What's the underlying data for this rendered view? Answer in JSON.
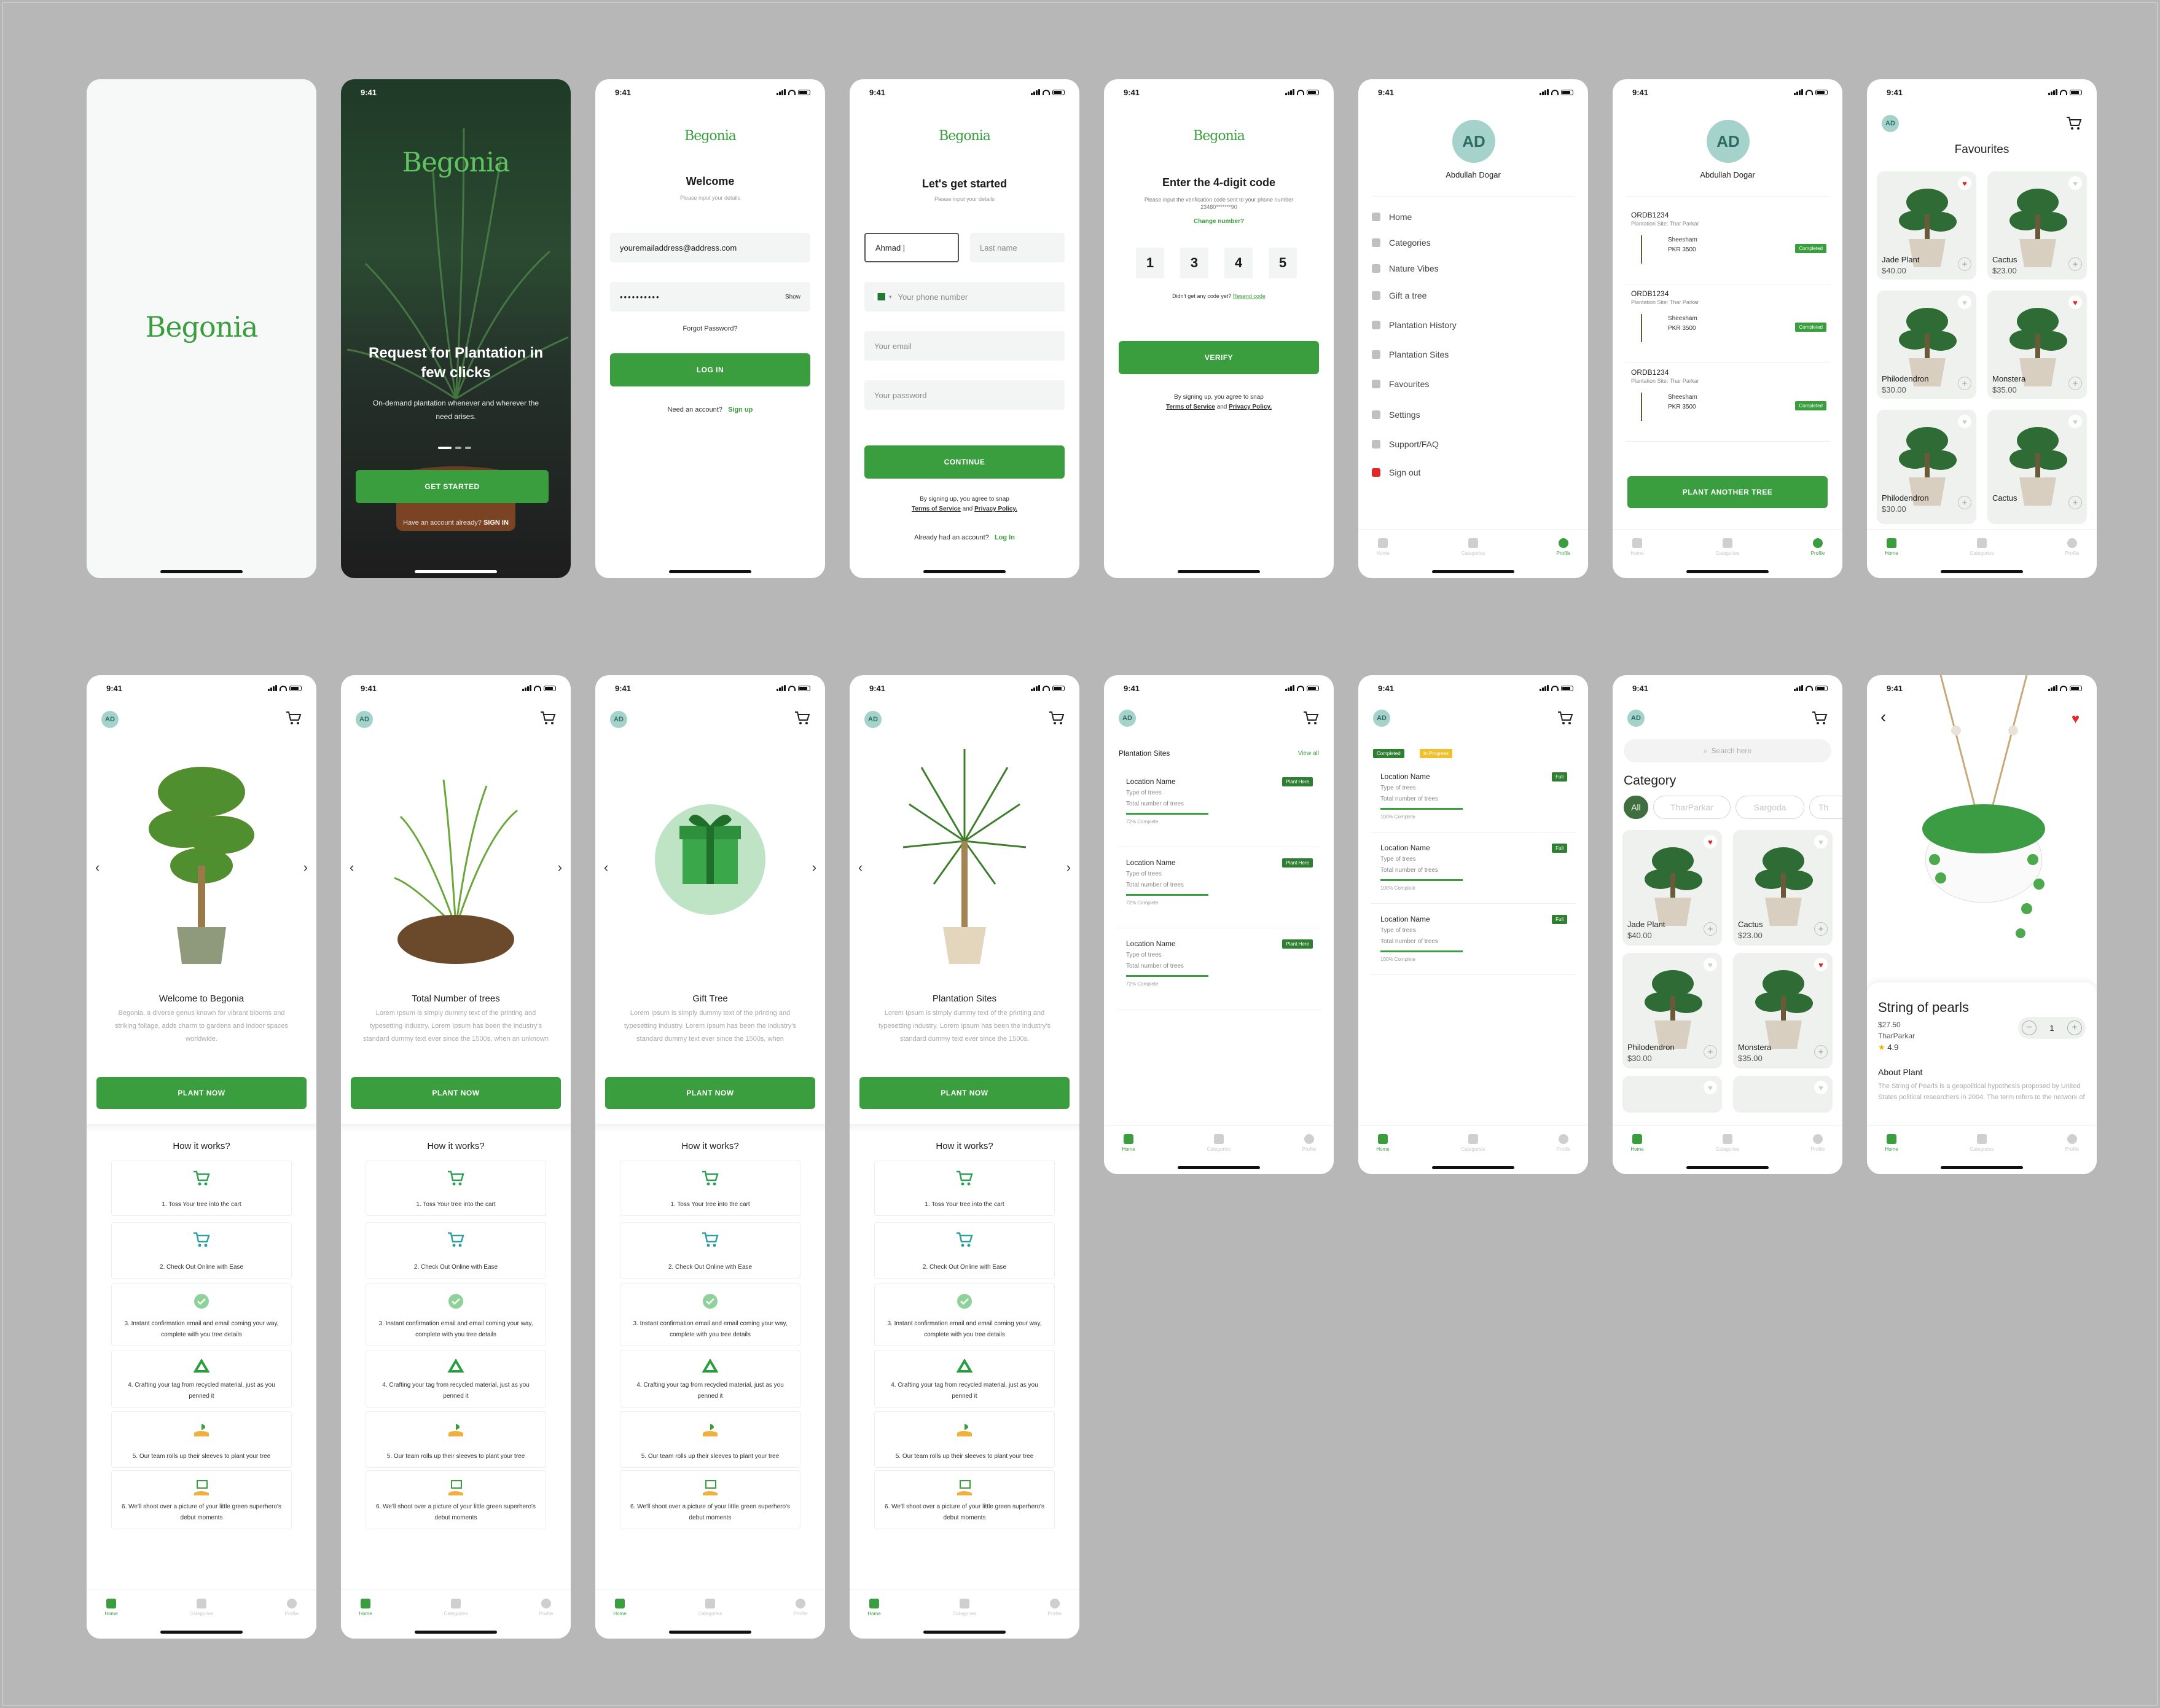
{
  "app": {
    "brand": "Begonia",
    "time": "9:41"
  },
  "splash2": {
    "title": "Request for Plantation in few clicks",
    "body": "On-demand plantation whenever and wherever the need arises.",
    "cta": "GET STARTED",
    "have_account": "Have an account already?",
    "sign_in": "SIGN IN"
  },
  "login": {
    "title": "Welcome",
    "subtitle": "Please input your details",
    "email": "youremailaddress@address.com",
    "password": "••••••••••",
    "show": "Show",
    "forgot": "Forgot Password?",
    "login_btn": "LOG IN",
    "need_account": "Need an account?",
    "sign_up": "Sign up"
  },
  "signup": {
    "title": "Let's get started",
    "subtitle": "Please input your details",
    "first_name": "Ahmad |",
    "last_name": "Last name",
    "phone": "Your phone number",
    "email": "Your email",
    "password": "Your password",
    "cta": "CONTINUE",
    "terms_prefix": "By signing up, you agree to snap",
    "terms": "Terms of Service",
    "and": "and",
    "privacy": "Privacy Policy.",
    "already": "Already had an account?",
    "log_in": "Log In"
  },
  "verify": {
    "title": "Enter the 4-digit code",
    "body": "Please input the verification code sent to your phone number 23480*******90",
    "change": "Change number?",
    "digits": [
      "1",
      "3",
      "4",
      "5"
    ],
    "resend_q": "Didn't get any code yet?",
    "resend": "Resend code",
    "cta": "VERIFY",
    "terms_prefix": "By signing up, you agree to snap",
    "terms": "Terms of Service",
    "and": "and",
    "privacy": "Privacy Policy."
  },
  "profile": {
    "initials": "AD",
    "name": "Abdullah Dogar",
    "menu": [
      "Home",
      "Categories",
      "Nature Vibes",
      "Gift a tree",
      "Plantation History",
      "Plantation Sites",
      "Favourites",
      "Settings",
      "Support/FAQ",
      "Sign out"
    ]
  },
  "nav": {
    "home": "Home",
    "categories": "Categories",
    "profile": "Profile"
  },
  "history": {
    "orders": [
      {
        "id": "ORDB1234",
        "site": "Plantation Site: Thar Parkar",
        "tree": "Sheesham",
        "price": "PKR 3500",
        "status": "Completed"
      },
      {
        "id": "ORDB1234",
        "site": "Plantation Site: Thar Parkar",
        "tree": "Sheesham",
        "price": "PKR 3500",
        "status": "Completed"
      },
      {
        "id": "ORDB1234",
        "site": "Plantation Site: Thar Parkar",
        "tree": "Sheesham",
        "price": "PKR 3500",
        "status": "Completed"
      }
    ],
    "cta": "PLANT ANOTHER TREE"
  },
  "favourites": {
    "title": "Favourites",
    "items": [
      {
        "name": "Jade Plant",
        "price": "$40.00",
        "fav": true
      },
      {
        "name": "Cactus",
        "price": "$23.00",
        "fav": false
      },
      {
        "name": "Philodendron",
        "price": "$30.00",
        "fav": false
      },
      {
        "name": "Monstera",
        "price": "$35.00",
        "fav": true
      },
      {
        "name": "Philodendron",
        "price": "$30.00",
        "fav": false
      },
      {
        "name": "Cactus",
        "price": "",
        "fav": false
      }
    ]
  },
  "onboard": [
    {
      "title": "Welcome to Begonia",
      "body": "Begonia, a diverse genus known for vibrant blooms and striking foliage, adds charm to gardens and indoor spaces worldwide.",
      "cta": "PLANT NOW"
    },
    {
      "title": "Total Number of trees",
      "body": "Lorem Ipsum is simply dummy text of the printing and typesetting industry. Lorem Ipsum has been the industry's standard dummy text ever since the 1500s, when an unknown",
      "cta": "PLANT NOW"
    },
    {
      "title": "Gift Tree",
      "body": "Lorem Ipsum is simply dummy text of the printing and typesetting industry. Lorem Ipsum has been the industry's standard dummy text ever since the 1500s, when",
      "cta": "PLANT NOW"
    },
    {
      "title": "Plantation Sites",
      "body": "Lorem Ipsum is simply dummy text of the printing and typesetting industry. Lorem Ipsum has been the industry's standard dummy text ever since the 1500s.",
      "cta": "PLANT NOW"
    }
  ],
  "how": {
    "title": "How it works?",
    "steps": [
      "1. Toss Your tree into the cart",
      "2. Check Out Online with Ease",
      "3. Instant confirmation email and email coming your way, complete with you tree details",
      "4. Crafting your tag from recycled material, just as you penned it",
      "5. Our team rolls up their sleeves to plant your tree",
      "6. We'll shoot over a picture of your little green superhero's debut moments"
    ]
  },
  "sites": {
    "title": "Plantation Sites",
    "view_all": "View all",
    "items": [
      {
        "name": "Location Name",
        "type": "Type of trees",
        "total": "Total number of trees",
        "progress": "72% Complete",
        "progress_value": 0.72,
        "badge": "Plant Here"
      },
      {
        "name": "Location Name",
        "type": "Type of trees",
        "total": "Total number of trees",
        "progress": "72% Complete",
        "progress_value": 0.72,
        "badge": "Plant Here"
      },
      {
        "name": "Location Name",
        "type": "Type of trees",
        "total": "Total number of trees",
        "progress": "72% Complete",
        "progress_value": 0.72,
        "badge": "Plant Here"
      }
    ]
  },
  "status_list": {
    "tab_completed": "Completed",
    "tab_progress": "In Progress",
    "items": [
      {
        "name": "Location Name",
        "type": "Type of trees",
        "total": "Total number of trees",
        "progress": "100% Complete",
        "badge": "Full"
      },
      {
        "name": "Location Name",
        "type": "Type of trees",
        "total": "Total number of trees",
        "progress": "100% Complete",
        "badge": "Full"
      },
      {
        "name": "Location Name",
        "type": "Type of trees",
        "total": "Total number of trees",
        "progress": "100% Complete",
        "badge": "Full"
      }
    ]
  },
  "category": {
    "search": "Search here",
    "title": "Category",
    "chips": [
      "All",
      "TharParkar",
      "Sargoda",
      "Th"
    ],
    "items": [
      {
        "name": "Jade Plant",
        "price": "$40.00",
        "fav": true
      },
      {
        "name": "Cactus",
        "price": "$23.00",
        "fav": false
      },
      {
        "name": "Philodendron",
        "price": "$30.00",
        "fav": false
      },
      {
        "name": "Monstera",
        "price": "$35.00",
        "fav": true
      }
    ]
  },
  "detail": {
    "name": "String of pearls",
    "price": "$27.50",
    "location": "TharParkar",
    "rating": "4.9",
    "qty": "1",
    "about": "About Plant",
    "desc": "The String of Pearls is a geopolitical hypothesis proposed by United States political researchers in 2004. The term refers to the network of"
  },
  "colors": {
    "accent": "#3a9e3e",
    "favourite": "#e02828",
    "avatar": "#a6d2cc"
  }
}
